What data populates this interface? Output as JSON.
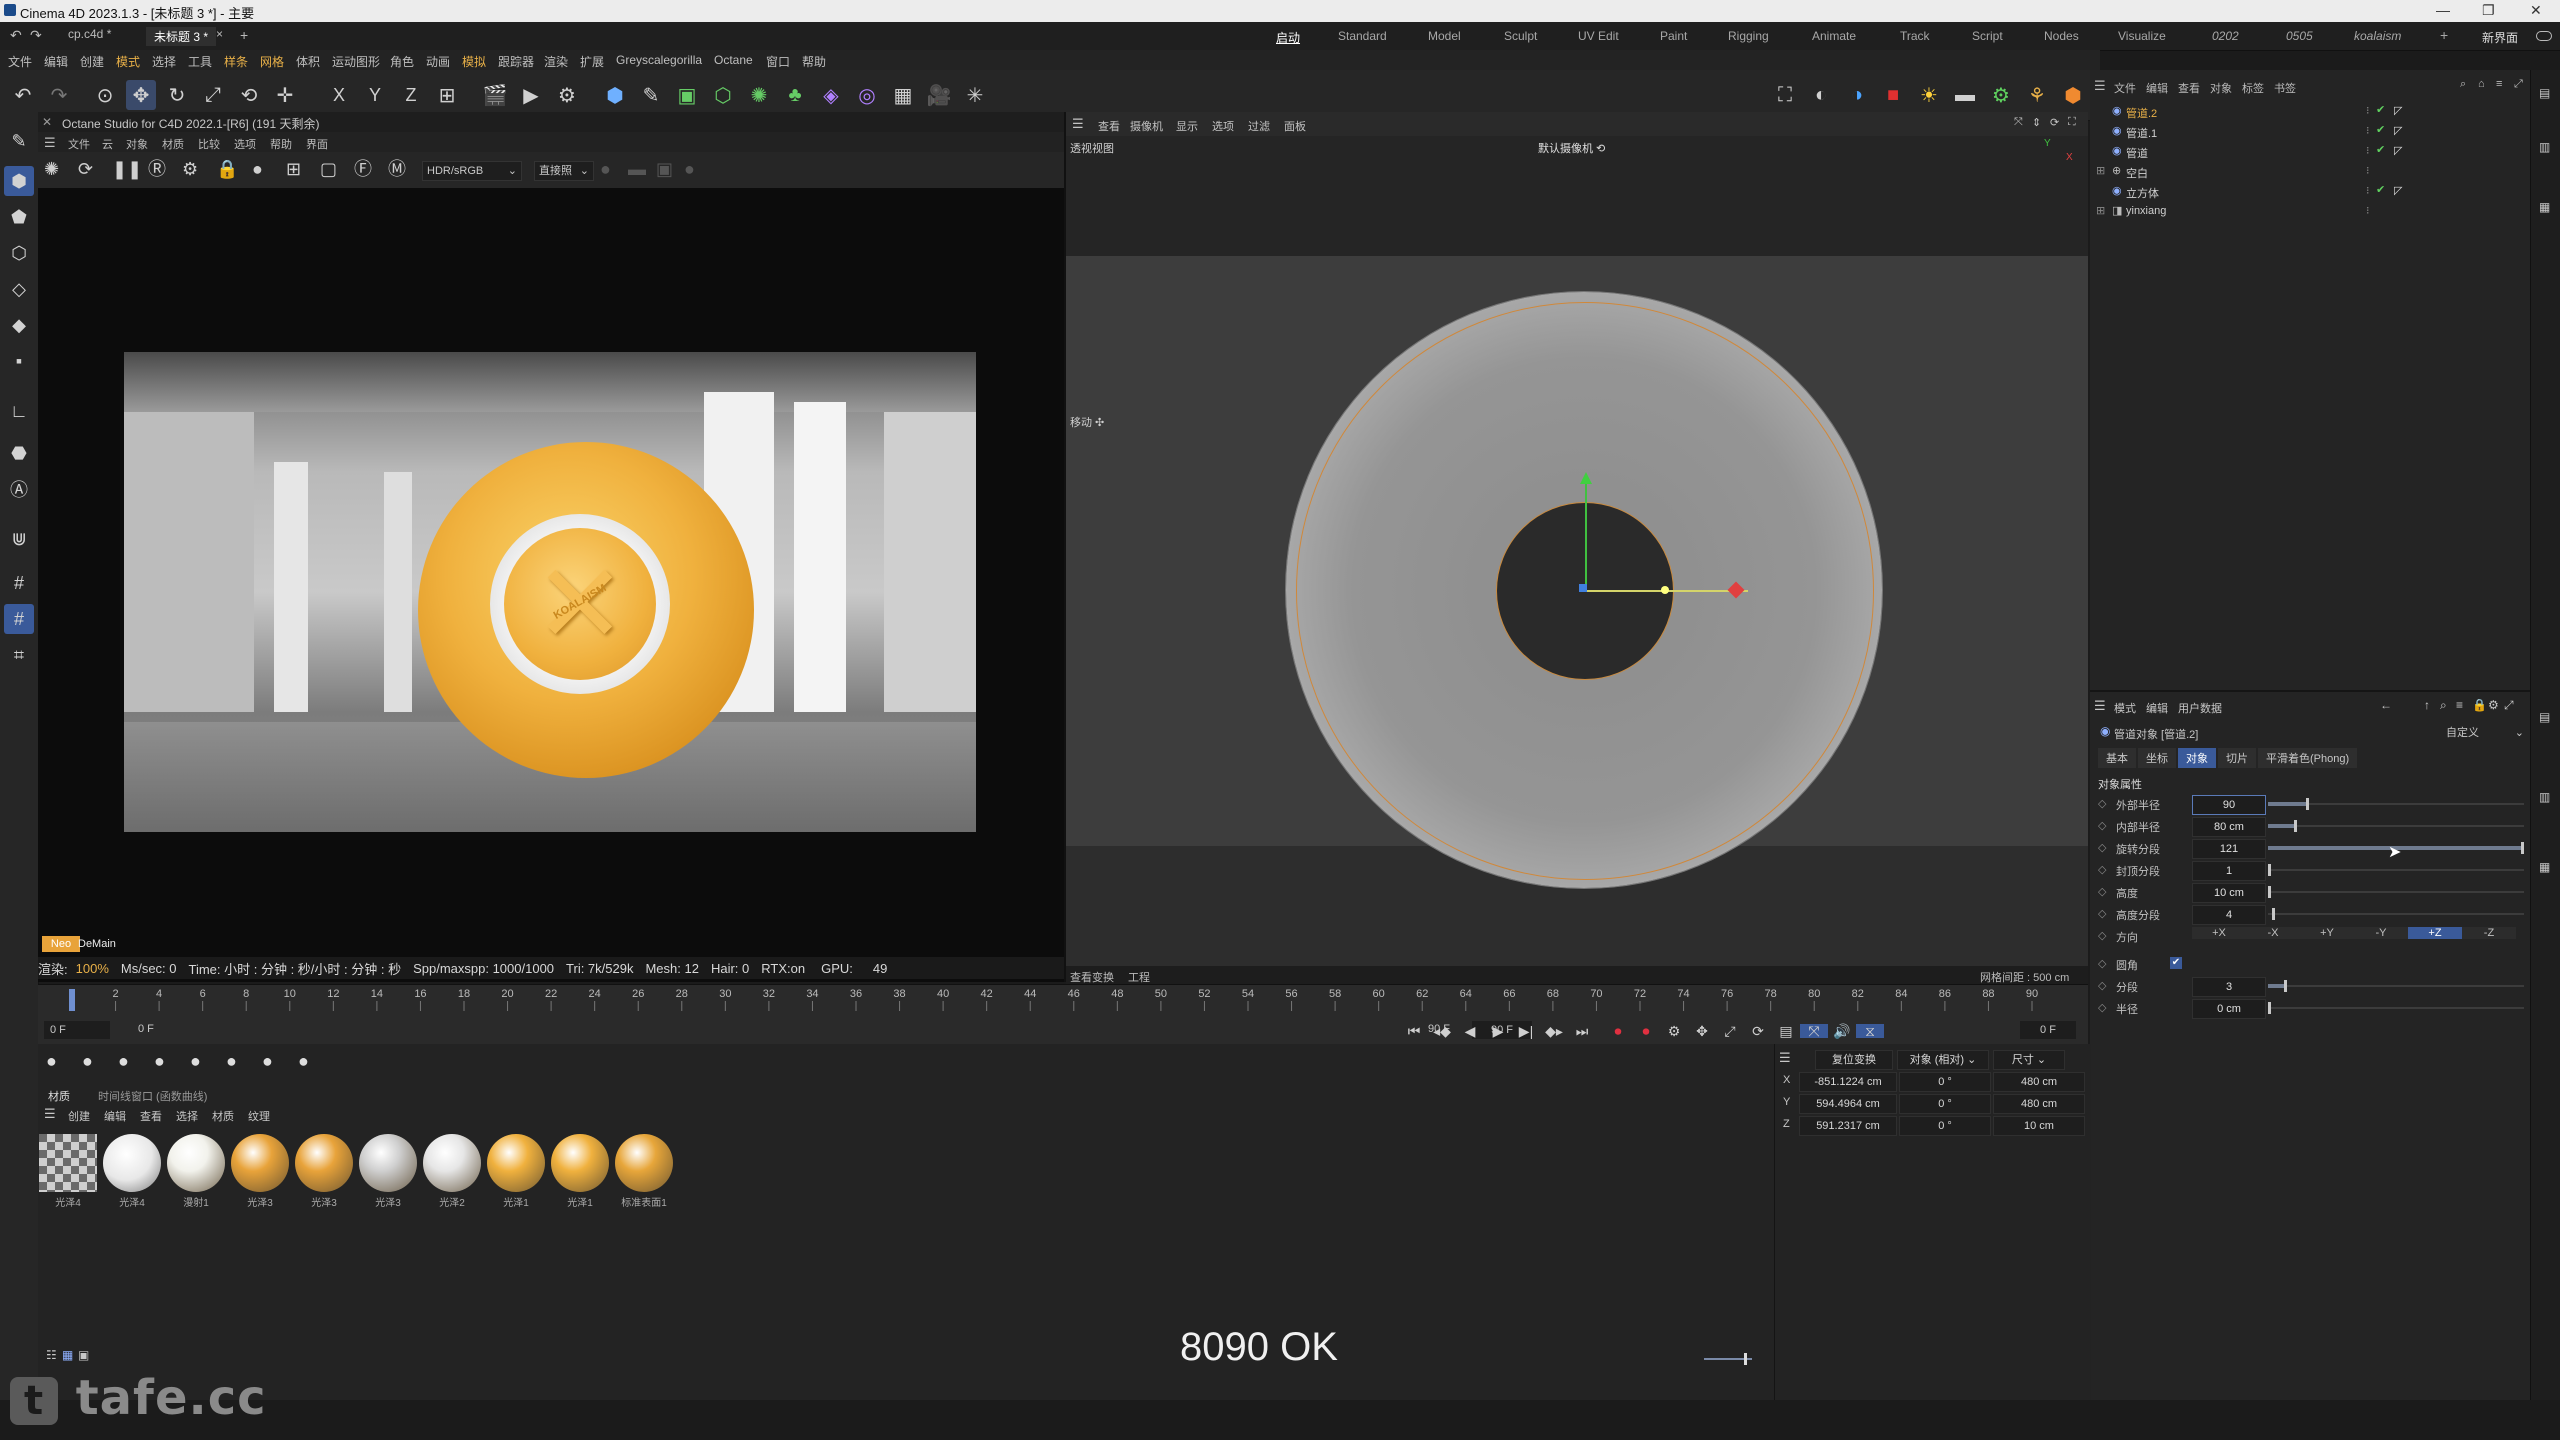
{
  "window": {
    "title": "Cinema 4D 2023.1.3 - [未标题 3 *] - 主要",
    "min": "—",
    "restore": "❐",
    "close": "✕"
  },
  "doc_tabs": [
    "cp.c4d *",
    "未标题 3 *"
  ],
  "doc_tab_close": "×",
  "doc_tab_add": "+",
  "layout_tabs": [
    "启动",
    "Standard",
    "Model",
    "Sculpt",
    "UV Edit",
    "Paint",
    "Rigging",
    "Animate",
    "Track",
    "Script",
    "Nodes",
    "Visualize",
    "0202",
    "0505",
    "koalaism"
  ],
  "layout_active": "启动",
  "layout_new": "新界面",
  "menu": [
    "文件",
    "编辑",
    "创建",
    "模式",
    "选择",
    "工具",
    "样条",
    "网格",
    "体积",
    "运动图形",
    "角色",
    "动画",
    "模拟",
    "跟踪器",
    "渲染",
    "扩展",
    "Greyscalegorilla",
    "Octane",
    "窗口",
    "帮助"
  ],
  "toolbar_axes": [
    "X",
    "Y",
    "Z"
  ],
  "octane": {
    "title": "Octane Studio for C4D 2022.1-[R6] (191 天剩余)",
    "menu": [
      "文件",
      "云",
      "对象",
      "材质",
      "比较",
      "选项",
      "帮助",
      "界面"
    ],
    "mode_select": "HDR/sRGB",
    "light_select": "直接照",
    "status_badge": "Neo",
    "status_badge2": "DeMain",
    "status": {
      "render_label": "渲染:",
      "render_value": "100%",
      "ms_sec": "Ms/sec: 0",
      "time": "Time: 小时 : 分钟 : 秒/小时 : 分钟 : 秒",
      "spp": "Spp/maxspp: 1000/1000",
      "tri": "Tri: 7k/529k",
      "mesh": "Mesh: 12",
      "hair": "Hair: 0",
      "rtx": "RTX:on",
      "gpu": "GPU:",
      "gpu_value": "49"
    },
    "logo_text": "KOALAISM"
  },
  "viewport": {
    "menu": [
      "查看",
      "摄像机",
      "显示",
      "选项",
      "过滤",
      "面板"
    ],
    "label": "透视视图",
    "camera": "默认摄像机 ⟲",
    "move_label": "移动 ✣",
    "bottom_left": [
      "查看变换",
      "工程"
    ],
    "grid": "网格间距 : 500 cm"
  },
  "object_manager": {
    "menu": [
      "文件",
      "编辑",
      "查看",
      "对象",
      "标签",
      "书签"
    ],
    "objects": [
      {
        "name": "管道.2",
        "selected": true,
        "checked": true
      },
      {
        "name": "管道.1",
        "selected": false,
        "checked": true
      },
      {
        "name": "管道",
        "selected": false,
        "checked": true
      },
      {
        "name": "空白",
        "selected": false,
        "checked": false
      },
      {
        "name": "立方体",
        "selected": false,
        "checked": true
      },
      {
        "name": "yinxiang",
        "selected": false,
        "checked": false
      }
    ]
  },
  "attributes": {
    "menu": [
      "模式",
      "编辑",
      "用户数据"
    ],
    "object_title": "管道对象 [管道.2]",
    "preset": "自定义",
    "tabs": [
      "基本",
      "坐标",
      "对象",
      "切片",
      "平滑着色(Phong)"
    ],
    "active_tab": "对象",
    "section": "对象属性",
    "rows": [
      {
        "label": "外部半径",
        "value": "90",
        "fill": 0.15
      },
      {
        "label": "内部半径",
        "value": "80 cm",
        "fill": 0.1
      },
      {
        "label": "旋转分段",
        "value": "121",
        "fill": 1.0
      },
      {
        "label": "封顶分段",
        "value": "1",
        "fill": 0.0
      },
      {
        "label": "高度",
        "value": "10 cm",
        "fill": 0.0
      },
      {
        "label": "高度分段",
        "value": "4",
        "fill": 0.01
      }
    ],
    "direction_label": "方向",
    "directions": [
      "+X",
      "-X",
      "+Y",
      "-Y",
      "+Z",
      "-Z"
    ],
    "direction_active": "+Z",
    "fillet_label": "圆角",
    "fillet_rows": [
      {
        "label": "分段",
        "value": "3",
        "fill": 0.06
      },
      {
        "label": "半径",
        "value": "0 cm",
        "fill": 0.0
      }
    ]
  },
  "timeline": {
    "ticks": [
      "0",
      "2",
      "4",
      "6",
      "8",
      "10",
      "12",
      "14",
      "16",
      "18",
      "20",
      "22",
      "24",
      "26",
      "28",
      "30",
      "32",
      "34",
      "36",
      "38",
      "40",
      "42",
      "44",
      "46",
      "48",
      "50",
      "52",
      "54",
      "56",
      "58",
      "60",
      "62",
      "64",
      "66",
      "68",
      "70",
      "72",
      "74",
      "76",
      "78",
      "80",
      "82",
      "84",
      "86",
      "88",
      "90"
    ],
    "current": "0 F",
    "start": "0 F",
    "range_start": "0 F",
    "range_end": "90 F",
    "end": "90 F",
    "end_display": "0 F"
  },
  "materials": {
    "tabs": [
      "材质",
      "时间线窗口 (函数曲线)"
    ],
    "menu": [
      "创建",
      "编辑",
      "查看",
      "选择",
      "材质",
      "纹理"
    ],
    "items": [
      {
        "name": "光泽4",
        "color": "#d8d8d8",
        "kind": "checker"
      },
      {
        "name": "光泽4",
        "color": "#e8e8e8",
        "kind": "pattern"
      },
      {
        "name": "漫射1",
        "color": "#f2f2ec",
        "kind": "ball"
      },
      {
        "name": "光泽3",
        "color": "#e8a33a",
        "kind": "ball"
      },
      {
        "name": "光泽3",
        "color": "#e8a33a",
        "kind": "ball"
      },
      {
        "name": "光泽3",
        "color": "#cfcfcf",
        "kind": "ball"
      },
      {
        "name": "光泽2",
        "color": "#e6e6e6",
        "kind": "ball"
      },
      {
        "name": "光泽1",
        "color": "#f0b13e",
        "kind": "ball"
      },
      {
        "name": "光泽1",
        "color": "#f0b13e",
        "kind": "ball"
      },
      {
        "name": "标准表面1",
        "color": "#e7a63a",
        "kind": "ball"
      }
    ]
  },
  "coordinates": {
    "dropdowns": [
      "复位变换",
      "对象 (相对)",
      "尺寸"
    ],
    "rows": [
      {
        "axis": "X",
        "pos": "-851.1224 cm",
        "rot": "0 °",
        "size": "480 cm"
      },
      {
        "axis": "Y",
        "pos": "594.4964 cm",
        "rot": "0 °",
        "size": "480 cm"
      },
      {
        "axis": "Z",
        "pos": "591.2317 cm",
        "rot": "0 °",
        "size": "10 cm"
      }
    ]
  },
  "subtitle": "8090 OK",
  "watermark": "tafe.cc",
  "colors": {
    "accent": "#e8b048",
    "selection": "#3a5a9a",
    "orange_obj": "#e9a23b"
  }
}
